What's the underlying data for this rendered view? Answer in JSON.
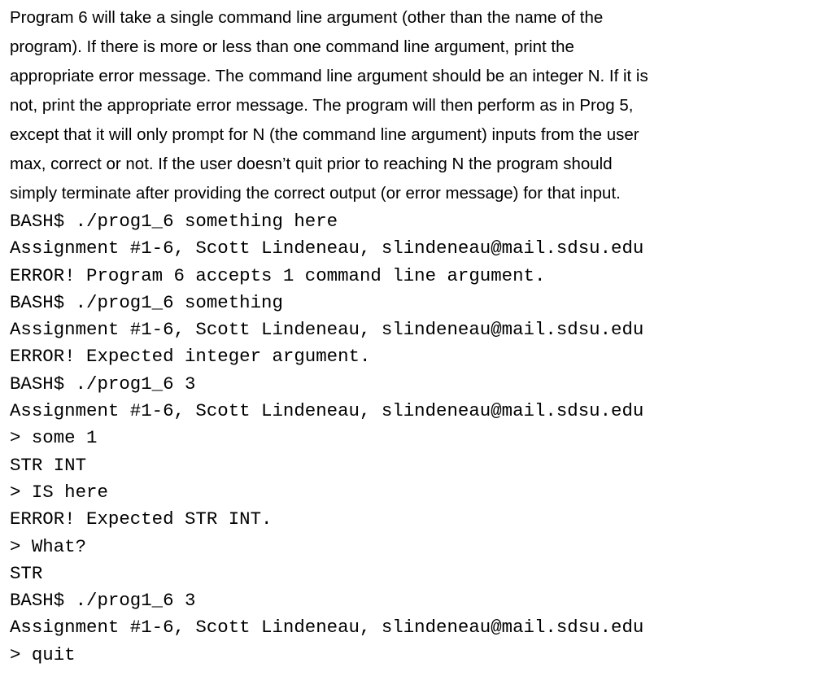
{
  "description_lines": [
    "Program 6 will take a single command line argument (other than the name of the",
    "program). If there is more or less than one command line argument, print the",
    "appropriate error message. The command line argument should be an integer N. If it is",
    "not, print the appropriate error message. The program will then perform as in Prog 5,",
    "except that it will only prompt for N (the command line argument) inputs from the user",
    "max, correct or not. If the user doesn’t quit prior to reaching N the program should",
    "simply terminate after providing the correct output (or error message) for that input."
  ],
  "terminal_lines": [
    "BASH$ ./prog1_6 something here",
    "Assignment #1-6, Scott Lindeneau, slindeneau@mail.sdsu.edu",
    "ERROR! Program 6 accepts 1 command line argument.",
    "BASH$ ./prog1_6 something",
    "Assignment #1-6, Scott Lindeneau, slindeneau@mail.sdsu.edu",
    "ERROR! Expected integer argument.",
    "BASH$ ./prog1_6 3",
    "Assignment #1-6, Scott Lindeneau, slindeneau@mail.sdsu.edu",
    "> some 1",
    "STR INT",
    "> IS here",
    "ERROR! Expected STR INT.",
    "> What?",
    "STR",
    "BASH$ ./prog1_6 3",
    "Assignment #1-6, Scott Lindeneau, slindeneau@mail.sdsu.edu",
    "> quit"
  ]
}
